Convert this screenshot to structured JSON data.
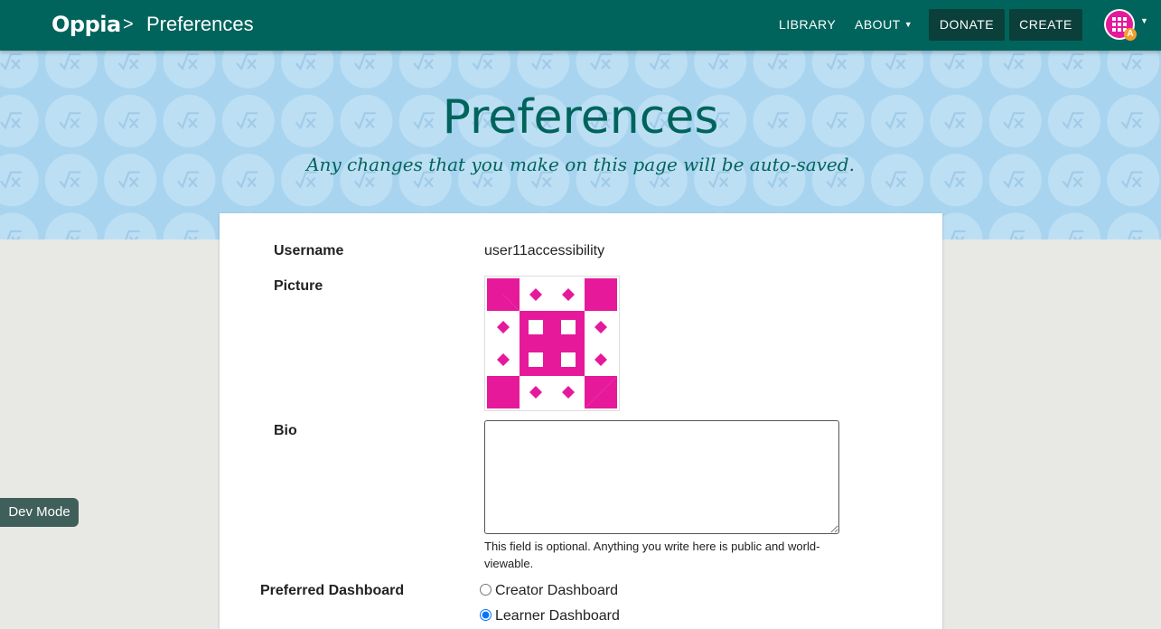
{
  "header": {
    "logo": "Oppia",
    "separator": ">",
    "page_title": "Preferences",
    "nav": {
      "library": "LIBRARY",
      "about": "ABOUT",
      "donate": "DONATE",
      "create": "CREATE"
    },
    "avatar_badge": "A"
  },
  "banner": {
    "title": "Preferences",
    "subtitle": "Any changes that you make on this page will be auto-saved."
  },
  "form": {
    "username_label": "Username",
    "username_value": "user11accessibility",
    "picture_label": "Picture",
    "bio_label": "Bio",
    "bio_value": "",
    "bio_help": "This field is optional. Anything you write here is public and world-viewable.",
    "dashboard_label": "Preferred Dashboard",
    "dashboard_options": {
      "creator": "Creator Dashboard",
      "learner": "Learner Dashboard"
    },
    "dashboard_selected": "learner"
  },
  "dev_mode": "Dev Mode",
  "colors": {
    "header": "#00645c",
    "banner": "#a8d4ef",
    "avatar": "#e6199b"
  }
}
